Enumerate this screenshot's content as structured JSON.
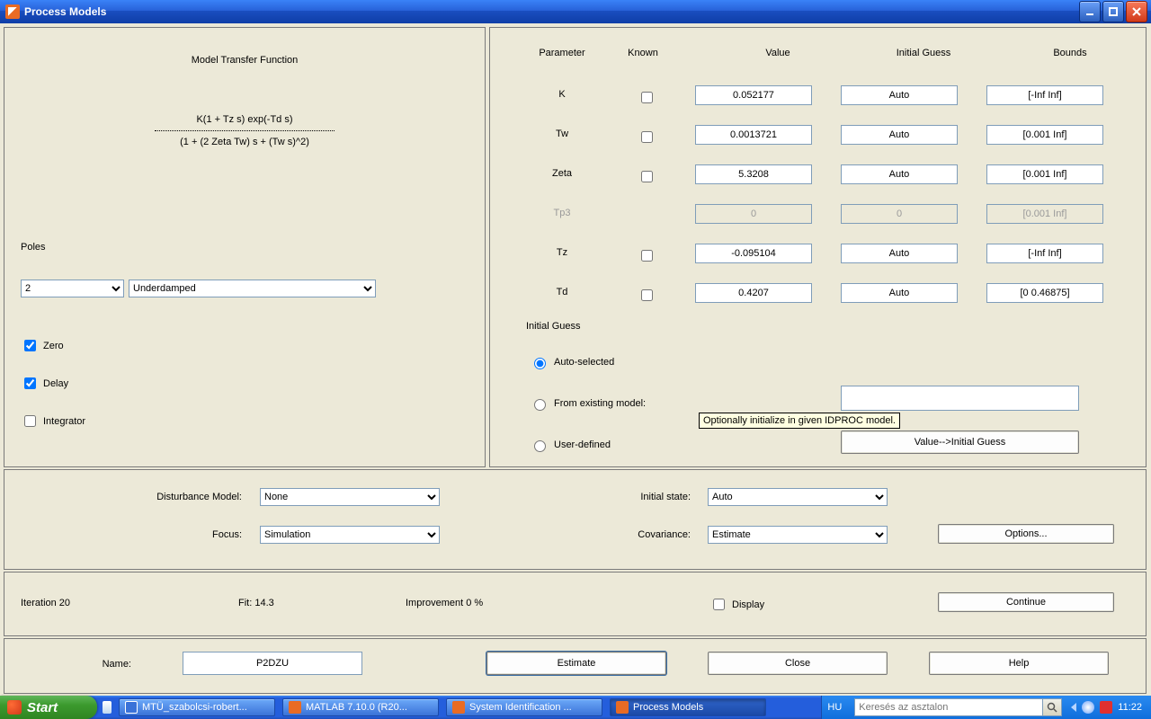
{
  "window": {
    "title": "Process Models"
  },
  "sysbuttons": {
    "min": "minimize",
    "max": "maximize",
    "close": "close"
  },
  "left": {
    "tfTitle": "Model Transfer Function",
    "tfNumerator": "K(1 + Tz s) exp(-Td s)",
    "tfDenominator": "(1 + (2 Zeta Tw) s + (Tw s)^2)",
    "polesLabel": "Poles",
    "polesCount": "2",
    "polesMode": "Underdamped",
    "zeroLabel": "Zero",
    "delayLabel": "Delay",
    "integratorLabel": "Integrator"
  },
  "right": {
    "headers": {
      "parameter": "Parameter",
      "known": "Known",
      "value": "Value",
      "initialGuess": "Initial Guess",
      "bounds": "Bounds"
    },
    "rows": [
      {
        "name": "K",
        "value": "0.052177",
        "guess": "Auto",
        "bounds": "[-Inf Inf]",
        "enabled": true
      },
      {
        "name": "Tw",
        "value": "0.0013721",
        "guess": "Auto",
        "bounds": "[0.001 Inf]",
        "enabled": true
      },
      {
        "name": "Zeta",
        "value": "5.3208",
        "guess": "Auto",
        "bounds": "[0.001 Inf]",
        "enabled": true
      },
      {
        "name": "Tp3",
        "value": "0",
        "guess": "0",
        "bounds": "[0.001 Inf]",
        "enabled": false
      },
      {
        "name": "Tz",
        "value": "-0.095104",
        "guess": "Auto",
        "bounds": "[-Inf Inf]",
        "enabled": true
      },
      {
        "name": "Td",
        "value": "0.4207",
        "guess": "Auto",
        "bounds": "[0 0.46875]",
        "enabled": true
      }
    ],
    "initialGuessLabel": "Initial Guess",
    "radios": {
      "auto": "Auto-selected",
      "existing": "From existing model:",
      "user": "User-defined"
    },
    "tooltip": "Optionally initialize in given IDPROC model.",
    "valueToGuessBtn": "Value-->Initial Guess"
  },
  "mid1": {
    "disturbanceLabel": "Disturbance Model:",
    "disturbanceValue": "None",
    "focusLabel": "Focus:",
    "focusValue": "Simulation",
    "initialStateLabel": "Initial state:",
    "initialStateValue": "Auto",
    "covarianceLabel": "Covariance:",
    "covarianceValue": "Estimate",
    "optionsBtn": "Options..."
  },
  "mid2": {
    "iteration": "Iteration 20",
    "fit": "Fit: 14.3",
    "improvement": "Improvement 0 %",
    "displayLabel": "Display",
    "continueBtn": "Continue"
  },
  "mid3": {
    "nameLabel": "Name:",
    "nameValue": "P2DZU",
    "estimateBtn": "Estimate",
    "closeBtn": "Close",
    "helpBtn": "Help"
  },
  "taskbar": {
    "start": "Start",
    "items": [
      "MTÜ_szabolcsi-robert...",
      "MATLAB  7.10.0 (R20...",
      "System Identification ...",
      "Process Models"
    ],
    "lang": "HU",
    "searchPlaceholder": "Keresés az asztalon",
    "clock": "11:22"
  }
}
